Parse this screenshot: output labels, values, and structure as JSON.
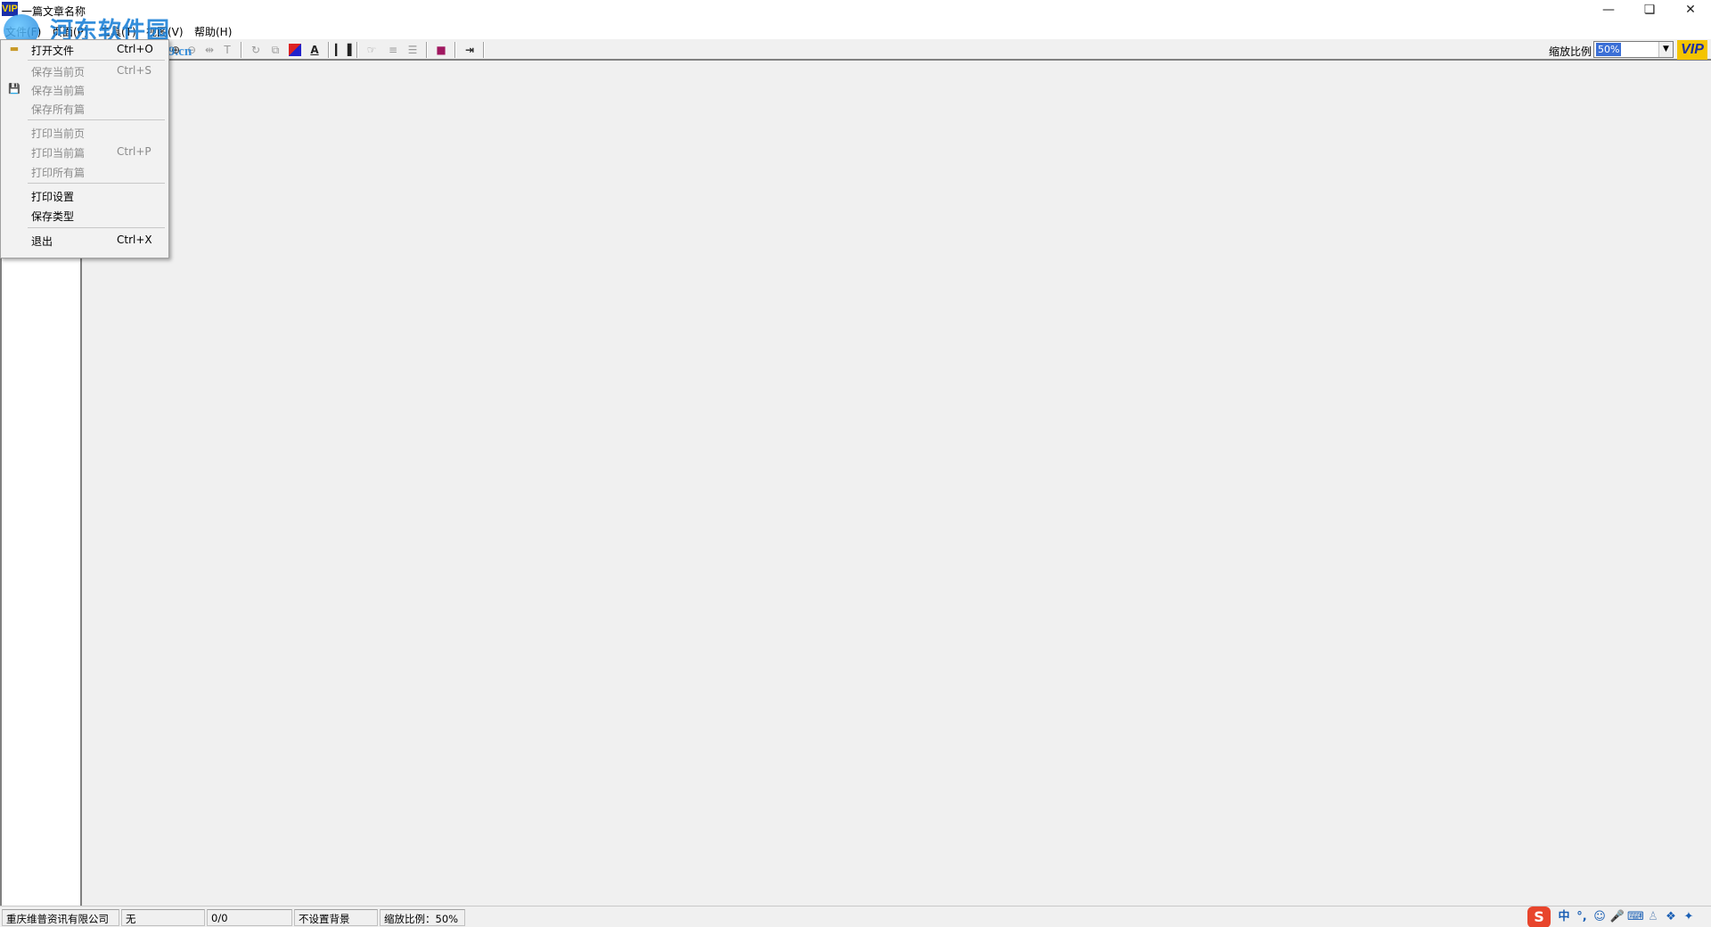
{
  "window": {
    "title": "一篇文章名称",
    "logo_text": "VIP",
    "minimize_icon": "minimize-icon",
    "maximize_icon": "restore-icon",
    "close_icon": "close-icon"
  },
  "menubar": {
    "items": [
      {
        "label": "文件(F)"
      },
      {
        "label": "页面(P)"
      },
      {
        "label": "工具(T)"
      },
      {
        "label": "视图(V)"
      },
      {
        "label": "帮助(H)"
      }
    ]
  },
  "watermark": {
    "text": "河东软件园",
    "url": "www.pc0359.cn"
  },
  "toolbar": {
    "zoom_label": "缩放比例",
    "zoom_value": "50%",
    "vip_badge": "VIP",
    "buttons": [
      {
        "icon": "open-folder-icon",
        "glyph": "📂",
        "active": true
      },
      {
        "icon": "zoom-in-icon",
        "glyph": "🔍",
        "active": false
      },
      {
        "icon": "zoom-out-icon",
        "glyph": "🔍",
        "active": false
      },
      {
        "icon": "fit-width-icon",
        "glyph": "⇹",
        "active": false
      },
      {
        "icon": "fit-text-icon",
        "glyph": "T",
        "active": false
      },
      {
        "icon": "rotate-icon",
        "glyph": "↻",
        "active": false
      },
      {
        "icon": "copy-icon",
        "glyph": "⧉",
        "active": false
      },
      {
        "icon": "color-background-icon",
        "glyph": "◪",
        "active": true
      },
      {
        "icon": "text-style-icon",
        "glyph": "A",
        "active": true
      },
      {
        "icon": "statistics-icon",
        "glyph": "▮",
        "active": true
      },
      {
        "icon": "select-icon",
        "glyph": "☞",
        "active": false
      },
      {
        "icon": "page-layout-icon",
        "glyph": "≡",
        "active": false
      },
      {
        "icon": "page-list-icon",
        "glyph": "☰",
        "active": false
      },
      {
        "icon": "book-icon",
        "glyph": "▰",
        "active": true
      },
      {
        "icon": "exit-icon",
        "glyph": "⇥",
        "active": true
      }
    ]
  },
  "file_menu": {
    "items": [
      {
        "label": "打开文件",
        "shortcut": "Ctrl+O",
        "disabled": false,
        "icon": "open-folder-icon"
      },
      {
        "separator": true
      },
      {
        "label": "保存当前页",
        "shortcut": "Ctrl+S",
        "disabled": true
      },
      {
        "label": "保存当前篇",
        "shortcut": "",
        "disabled": true,
        "icon": "save-icon"
      },
      {
        "label": "保存所有篇",
        "shortcut": "",
        "disabled": true
      },
      {
        "separator": true
      },
      {
        "label": "打印当前页",
        "shortcut": "",
        "disabled": true
      },
      {
        "label": "打印当前篇",
        "shortcut": "Ctrl+P",
        "disabled": true
      },
      {
        "label": "打印所有篇",
        "shortcut": "",
        "disabled": true
      },
      {
        "separator": true
      },
      {
        "label": "打印设置",
        "shortcut": "",
        "disabled": false
      },
      {
        "label": "保存类型",
        "shortcut": "",
        "disabled": false
      },
      {
        "separator": true
      },
      {
        "label": "退出",
        "shortcut": "Ctrl+X",
        "disabled": false
      }
    ]
  },
  "statusbar": {
    "company": "重庆维普资讯有限公司",
    "field2": "无",
    "pages": "0/0",
    "background": "不设置背景",
    "zoom": "缩放比例：50%"
  },
  "ime": {
    "logo": "S",
    "mode": "中",
    "icons": [
      "punctuation-icon",
      "emoji-icon",
      "microphone-icon",
      "keyboard-icon",
      "user-icon",
      "skin-icon",
      "settings-icon"
    ]
  },
  "colors": {
    "title_bg": "#ffffff",
    "workspace_bg": "#f0f0f0",
    "zoom_highlight": "#3b6fd6",
    "vip_yellow": "#f4c400",
    "watermark_blue": "#1f82d8",
    "ime_red": "#e8452c"
  }
}
